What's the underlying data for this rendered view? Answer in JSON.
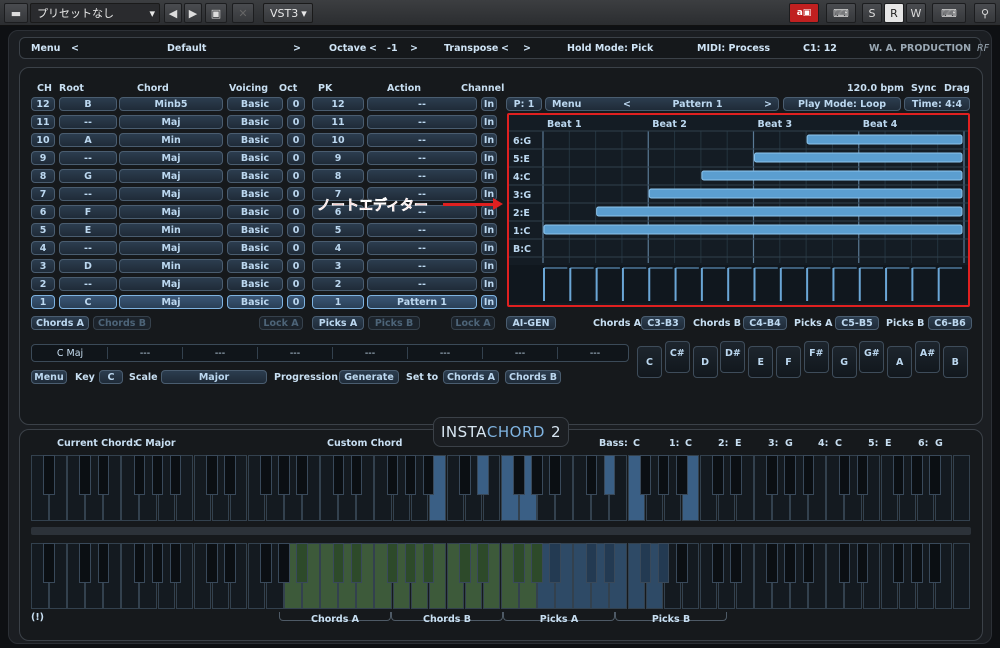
{
  "host": {
    "preset": "プリセットなし",
    "plugin": "VST3",
    "btn_s": "S",
    "btn_r": "R",
    "btn_w": "W"
  },
  "topbar": {
    "menu": "Menu",
    "prev": "<",
    "preset": "Default",
    "next": ">",
    "octave_label": "Octave",
    "octave_value": "-1",
    "transpose_label": "Transpose",
    "hold": "Hold Mode: Pick",
    "midi": "MIDI: Process",
    "c1": "C1: 12",
    "brand": "W. A. PRODUCTION",
    "brand_suffix": "RF"
  },
  "headers": {
    "ch": "CH",
    "root": "Root",
    "chord": "Chord",
    "voicing": "Voicing",
    "oct": "Oct",
    "pk": "PK",
    "action": "Action",
    "channel": "Channel",
    "bpm": "120.0 bpm",
    "sync": "Sync",
    "drag": "Drag"
  },
  "rows": [
    {
      "ch": "12",
      "root": "B",
      "chord": "Minb5",
      "voicing": "Basic",
      "oct": "0",
      "pk": "12",
      "action": "--",
      "channel": "In"
    },
    {
      "ch": "11",
      "root": "--",
      "chord": "Maj",
      "voicing": "Basic",
      "oct": "0",
      "pk": "11",
      "action": "--",
      "channel": "In"
    },
    {
      "ch": "10",
      "root": "A",
      "chord": "Min",
      "voicing": "Basic",
      "oct": "0",
      "pk": "10",
      "action": "--",
      "channel": "In"
    },
    {
      "ch": "9",
      "root": "--",
      "chord": "Maj",
      "voicing": "Basic",
      "oct": "0",
      "pk": "9",
      "action": "--",
      "channel": "In"
    },
    {
      "ch": "8",
      "root": "G",
      "chord": "Maj",
      "voicing": "Basic",
      "oct": "0",
      "pk": "8",
      "action": "--",
      "channel": "In"
    },
    {
      "ch": "7",
      "root": "--",
      "chord": "Maj",
      "voicing": "Basic",
      "oct": "0",
      "pk": "7",
      "action": "--",
      "channel": "In"
    },
    {
      "ch": "6",
      "root": "F",
      "chord": "Maj",
      "voicing": "Basic",
      "oct": "0",
      "pk": "6",
      "action": "--",
      "channel": "In"
    },
    {
      "ch": "5",
      "root": "E",
      "chord": "Min",
      "voicing": "Basic",
      "oct": "0",
      "pk": "5",
      "action": "--",
      "channel": "In"
    },
    {
      "ch": "4",
      "root": "--",
      "chord": "Maj",
      "voicing": "Basic",
      "oct": "0",
      "pk": "4",
      "action": "--",
      "channel": "In"
    },
    {
      "ch": "3",
      "root": "D",
      "chord": "Min",
      "voicing": "Basic",
      "oct": "0",
      "pk": "3",
      "action": "--",
      "channel": "In"
    },
    {
      "ch": "2",
      "root": "--",
      "chord": "Maj",
      "voicing": "Basic",
      "oct": "0",
      "pk": "2",
      "action": "--",
      "channel": "In"
    },
    {
      "ch": "1",
      "root": "C",
      "chord": "Maj",
      "voicing": "Basic",
      "oct": "0",
      "pk": "1",
      "action": "Pattern 1",
      "channel": "In"
    }
  ],
  "rowbtns": {
    "chords_a": "Chords A",
    "chords_b": "Chords B",
    "lock_a": "Lock A",
    "picks_a": "Picks A",
    "picks_b": "Picks B",
    "lock_a2": "Lock A",
    "ai_gen": "AI-GEN"
  },
  "ranges": {
    "chords_a_label": "Chords A",
    "chords_a": "C3-B3",
    "chords_b_label": "Chords B",
    "chords_b": "C4-B4",
    "picks_a_label": "Picks A",
    "picks_a": "C5-B5",
    "picks_b_label": "Picks B",
    "picks_b": "C6-B6"
  },
  "pattern": {
    "p": "P: 1",
    "menu": "Menu",
    "prev": "<",
    "name": "Pattern 1",
    "next": ">",
    "play_mode": "Play Mode: Loop",
    "time": "Time: 4:4",
    "beats": [
      "Beat 1",
      "Beat 2",
      "Beat 3",
      "Beat 4"
    ],
    "notes": [
      "6:G",
      "5:E",
      "4:C",
      "3:G",
      "2:E",
      "1:C",
      "B:C"
    ]
  },
  "annotation": "ノートエディター",
  "progression": {
    "slots": [
      "C Maj",
      "---",
      "---",
      "---",
      "---",
      "---",
      "---",
      "---"
    ],
    "menu": "Menu",
    "key_label": "Key",
    "key": "C",
    "scale_label": "Scale",
    "scale": "Major",
    "prog_label": "Progression",
    "generate": "Generate",
    "set_to": "Set to",
    "chords_a": "Chords A",
    "chords_b": "Chords B"
  },
  "pads": [
    "C",
    "C#",
    "D",
    "D#",
    "E",
    "F",
    "F#",
    "G",
    "G#",
    "A",
    "A#",
    "B"
  ],
  "bottom": {
    "current_label": "Current Chord:",
    "current": "C Major",
    "custom": "Custom Chord",
    "logo_a": "INSTA",
    "logo_b": "CHORD",
    "logo_c": "2",
    "bass_label": "Bass:",
    "bass": "C",
    "n1": "1:",
    "v1": "C",
    "n2": "2:",
    "v2": "E",
    "n3": "3:",
    "v3": "G",
    "n4": "4:",
    "v4": "C",
    "n5": "5:",
    "v5": "E",
    "n6": "6:",
    "v6": "G",
    "warn": "(!)",
    "zones": [
      "Chords A",
      "Chords B",
      "Picks A",
      "Picks B"
    ]
  },
  "colors": {
    "accent": "#5b9ed0",
    "highlight": "#e02020",
    "chord_zone": "#3d5a3a",
    "pick_zone": "#2e4a66"
  }
}
